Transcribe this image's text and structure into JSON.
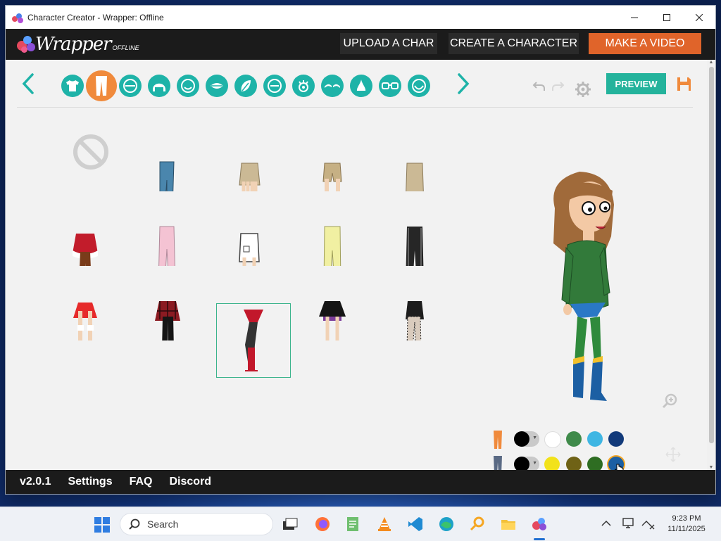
{
  "window": {
    "title": "Character Creator - Wrapper: Offline",
    "controls": [
      "—",
      "☐",
      "✕"
    ]
  },
  "topnav": {
    "logo_main": "Wrapper",
    "logo_sub": "OFFLINE",
    "upload_label": "UPLOAD A CHAR",
    "create_label": "CREATE A CHARACTER",
    "video_label": "MAKE A VIDEO"
  },
  "toolbar": {
    "categories": [
      {
        "name": "upper-body",
        "icon": "shirt-icon"
      },
      {
        "name": "lower-body",
        "icon": "pants-icon",
        "active": true
      },
      {
        "name": "head",
        "icon": "face-outline-icon"
      },
      {
        "name": "hair",
        "icon": "hair-icon"
      },
      {
        "name": "face-shape",
        "icon": "face-icon"
      },
      {
        "name": "mouth",
        "icon": "mouth-icon"
      },
      {
        "name": "accessory",
        "icon": "leaf-icon"
      },
      {
        "name": "facial-feature",
        "icon": "circle-icon"
      },
      {
        "name": "eyes",
        "icon": "eye-icon"
      },
      {
        "name": "eyebrows",
        "icon": "eyebrows-icon"
      },
      {
        "name": "nose",
        "icon": "nose-icon"
      },
      {
        "name": "glasses",
        "icon": "glasses-icon"
      },
      {
        "name": "beard",
        "icon": "beard-icon"
      }
    ],
    "preview_label": "PREVIEW"
  },
  "colors": {
    "accent": "#1eb3a8",
    "active_tab": "#f08a3c",
    "selected_outline": "#3bb48c",
    "preview": "#24b39c",
    "make_video": "#e0642a"
  },
  "grid": {
    "items": [
      "none",
      "jeans-blue",
      "khaki-skirt",
      "khaki-shorts",
      "khaki-long-skirt",
      "red-santa-skirt",
      "pink-pants",
      "white-skirt",
      "yellow-pants",
      "black-track-pants",
      "red-skirt",
      "plaid-skirt-boots",
      "red-boots-leotard",
      "black-skirt",
      "fishnet-skirt"
    ],
    "selected_index": 12
  },
  "color_rows": [
    {
      "part": "pants",
      "swatches": [
        "#ffffff",
        "#3f8a4a",
        "#3fb6e3",
        "#123a7a"
      ],
      "picker": "#000000"
    },
    {
      "part": "leggings",
      "swatches": [
        "#f2e21a",
        "#6f6216",
        "#2e6d22",
        "#1c5fa3"
      ],
      "picker": "#000000",
      "selected": 3
    }
  ],
  "footer": {
    "version": "v2.0.1",
    "settings": "Settings",
    "faq": "FAQ",
    "discord": "Discord"
  },
  "taskbar": {
    "search_placeholder": "Search",
    "time": "9:23 PM",
    "date": "11/11/2025"
  }
}
